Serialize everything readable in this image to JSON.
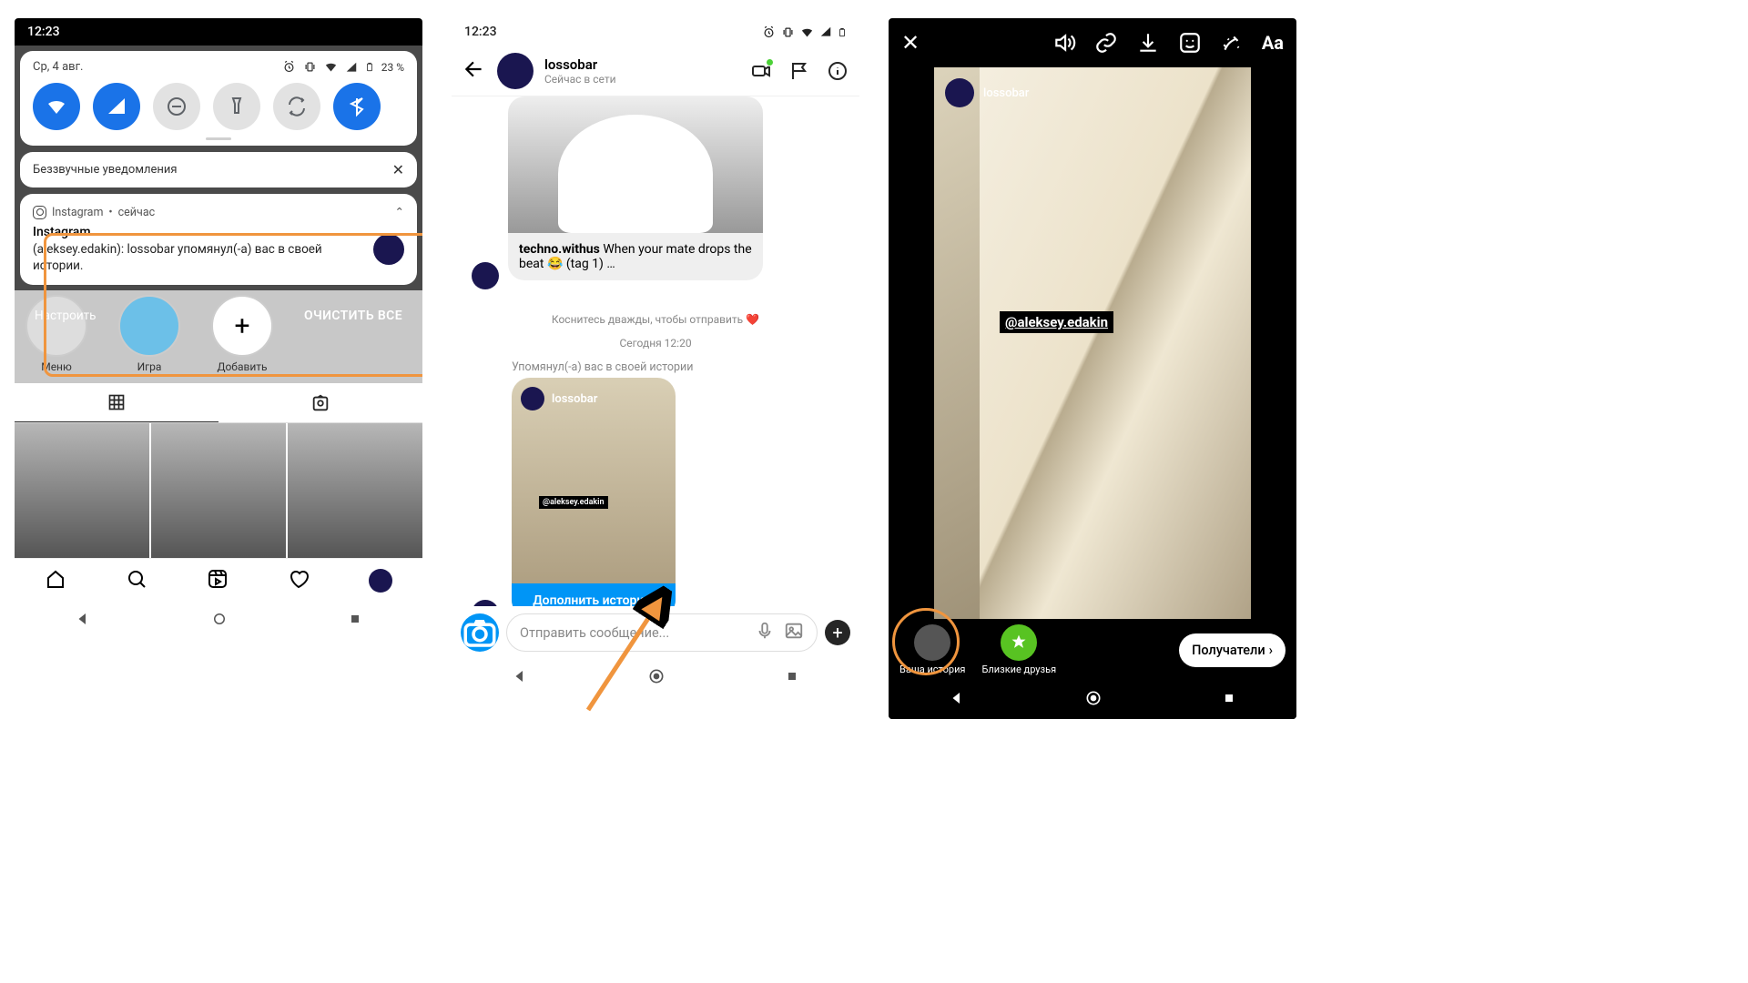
{
  "screen1": {
    "statusbar_time": "12:23",
    "qs_date": "Ср, 4 авг.",
    "battery": "23 %",
    "silent_header": "Беззвучные уведомления",
    "notif": {
      "app": "Instagram",
      "sep": " • ",
      "time": "сейчас",
      "title": "Instagram",
      "body": "(aleksey.edakin): lossobar упомянул(‑а) вас в своей истории."
    },
    "setup": "Настроить",
    "clear_all": "ОЧИСТИТЬ ВСЕ",
    "highlights": [
      "Меню",
      "Игра",
      "Добавить"
    ]
  },
  "screen2": {
    "statusbar_time": "12:23",
    "username": "lossobar",
    "presence": "Сейчас в сети",
    "post_user": "techno.withus",
    "post_text": " When your mate drops the beat 😂 (tag 1) …",
    "hint": "Коснитесь дважды, чтобы отправить ❤️",
    "timestamp": "Сегодня 12:20",
    "mention_label": "Упомянул(‑а) вас в своей истории",
    "story_user": "lossobar",
    "story_tag": "@aleksey.edakin",
    "story_cta": "Дополнить историю",
    "composer_placeholder": "Отправить сообщение..."
  },
  "screen3": {
    "aa": "Aa",
    "story_user": "lossobar",
    "mention": "@aleksey.edakin",
    "your_story": "Ваша история",
    "close_friends": "Близкие друзья",
    "recipients": "Получатели"
  }
}
